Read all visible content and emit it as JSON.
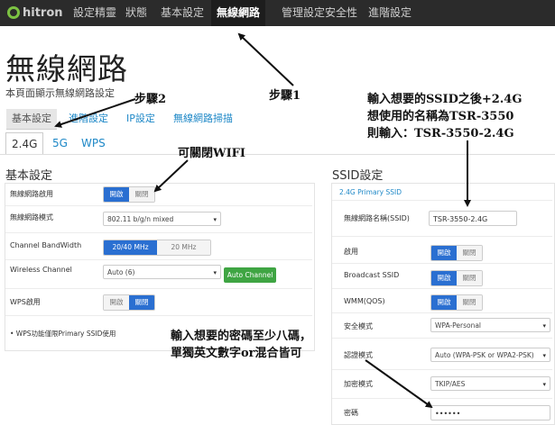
{
  "nav": {
    "logo_text": "hitron",
    "items": [
      "設定精靈",
      "狀態",
      "基本設定",
      "無線網路",
      "管理設定",
      "安全性",
      "進階設定"
    ],
    "active_index": 3
  },
  "header": {
    "title": "無線網路",
    "description": "本頁面顯示無線網路設定"
  },
  "subtabs": {
    "items": [
      "基本設定",
      "進階設定",
      "IP設定",
      "無線網路掃描"
    ],
    "active_index": 0
  },
  "band_tabs": {
    "items": [
      "2.4G",
      "5G",
      "WPS"
    ],
    "active_index": 0
  },
  "basic": {
    "title": "基本設定",
    "rows": {
      "wireless_enable": {
        "label": "無線網路啟用",
        "on": "開啟",
        "off": "關閉",
        "state": "on"
      },
      "wireless_mode": {
        "label": "無線網路模式",
        "value": "802.11 b/g/n mixed"
      },
      "bandwidth": {
        "label": "Channel BandWidth",
        "opt1": "20/40 MHz",
        "opt2": "20 MHz",
        "selected": "opt1"
      },
      "channel": {
        "label": "Wireless Channel",
        "value": "Auto (6)",
        "button": "Auto Channel"
      },
      "wps": {
        "label": "WPS啟用",
        "on": "開啟",
        "off": "關閉",
        "state": "off"
      }
    },
    "footnote": "• WPS功能僅限Primary SSID使用"
  },
  "ssid": {
    "title": "SSID設定",
    "subtitle": "2.4G Primary SSID",
    "rows": {
      "name": {
        "label": "無線網路名稱(SSID)",
        "value": "TSR-3550-2.4G"
      },
      "enable": {
        "label": "啟用",
        "on": "開啟",
        "off": "關閉",
        "state": "on"
      },
      "broadcast": {
        "label": "Broadcast SSID",
        "on": "開啟",
        "off": "關閉",
        "state": "on"
      },
      "wmm": {
        "label": "WMM(QOS)",
        "on": "開啟",
        "off": "關閉",
        "state": "on"
      },
      "security_mode": {
        "label": "安全模式",
        "value": "WPA-Personal"
      },
      "auth_mode": {
        "label": "認證模式",
        "value": "Auto (WPA-PSK or WPA2-PSK)"
      },
      "encryption": {
        "label": "加密模式",
        "value": "TKIP/AES"
      },
      "password": {
        "label": "密碼",
        "value": "••••••"
      }
    }
  },
  "annotations": {
    "step1": "步驟1",
    "step2": "步驟2",
    "wifi_toggle": "可關閉WIFI",
    "ssid_line1": "輸入想要的SSID之後+2.4G",
    "ssid_line2": "想使用的名稱為TSR-3550",
    "ssid_line3": "則輸入：TSR-3550-2.4G",
    "pw_line1": "輸入想要的密碼至少八碼，",
    "pw_line2": "單獨英文數字or混合皆可"
  },
  "colors": {
    "nav_bg": "#2b2b2b",
    "link": "#1e88c7",
    "toggle_on": "#2a6fd1",
    "green": "#3fa543"
  }
}
